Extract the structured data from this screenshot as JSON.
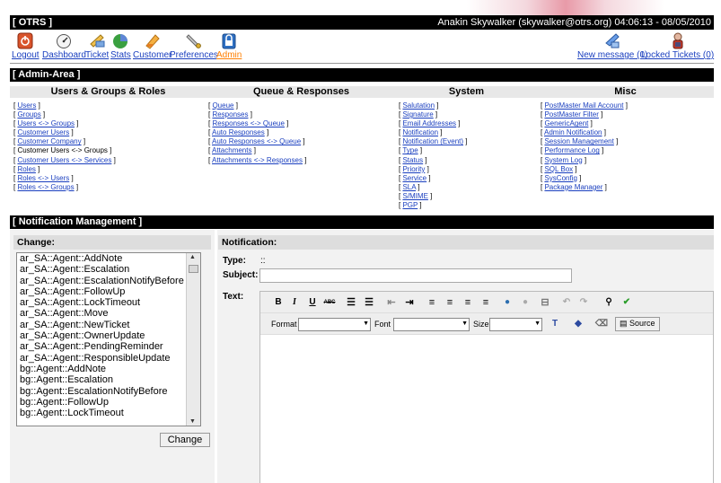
{
  "header": {
    "logo": "[ OTRS ]",
    "user_info": "Anakin Skywalker (skywalker@otrs.org) 04:06:13 - 08/05/2010"
  },
  "nav": {
    "items": [
      {
        "label": "Logout",
        "icon": "logout-icon"
      },
      {
        "label": "Dashboard",
        "icon": "dashboard-icon"
      },
      {
        "label": "Ticket",
        "icon": "ticket-icon"
      },
      {
        "label": "Stats",
        "icon": "stats-icon"
      },
      {
        "label": "Customer",
        "icon": "customer-icon"
      },
      {
        "label": "Preferences",
        "icon": "preferences-icon"
      },
      {
        "label": "Admin",
        "icon": "admin-icon"
      }
    ],
    "new_message": "New message (0)",
    "locked_tickets": "Locked Tickets (0)"
  },
  "admin_area": {
    "title": "[ Admin-Area ]",
    "columns": [
      {
        "heading": "Users & Groups & Roles",
        "links": [
          "Users",
          "Groups",
          "Users <-> Groups",
          "Customer Users",
          "Customer Company",
          "Customer Users <-> Groups",
          "Customer Users <-> Services",
          "Roles",
          "Roles <-> Users",
          "Roles <-> Groups"
        ]
      },
      {
        "heading": "Queue & Responses",
        "links": [
          "Queue",
          "Responses",
          "Responses <-> Queue",
          "Auto Responses",
          "Auto Responses <-> Queue",
          "Attachments",
          "Attachments <-> Responses"
        ]
      },
      {
        "heading": "System",
        "links": [
          "Salutation",
          "Signature",
          "Email Addresses",
          "Notification",
          "Notification (Event)",
          "Type",
          "Status",
          "Priority",
          "Service",
          "SLA",
          "S/MIME",
          "PGP"
        ]
      },
      {
        "heading": "Misc",
        "links": [
          "PostMaster Mail Account",
          "PostMaster Filter",
          "GenericAgent",
          "Admin Notification",
          "Session Management",
          "Performance Log",
          "System Log",
          "SQL Box",
          "SysConfig",
          "Package Manager"
        ]
      }
    ]
  },
  "notification_management": {
    "title": "[ Notification Management ]",
    "change_heading": "Change:",
    "options": [
      "ar_SA::Agent::AddNote",
      "ar_SA::Agent::Escalation",
      "ar_SA::Agent::EscalationNotifyBefore",
      "ar_SA::Agent::FollowUp",
      "ar_SA::Agent::LockTimeout",
      "ar_SA::Agent::Move",
      "ar_SA::Agent::NewTicket",
      "ar_SA::Agent::OwnerUpdate",
      "ar_SA::Agent::PendingReminder",
      "ar_SA::Agent::ResponsibleUpdate",
      "bg::Agent::AddNote",
      "bg::Agent::Escalation",
      "bg::Agent::EscalationNotifyBefore",
      "bg::Agent::FollowUp",
      "bg::Agent::LockTimeout"
    ],
    "change_button": "Change",
    "notification_heading": "Notification:",
    "type_label": "Type:",
    "type_value": "::",
    "subject_label": "Subject:",
    "subject_value": "",
    "text_label": "Text:",
    "editor": {
      "format_label": "Format",
      "font_label": "Font",
      "size_label": "Size",
      "source_label": "Source"
    }
  }
}
